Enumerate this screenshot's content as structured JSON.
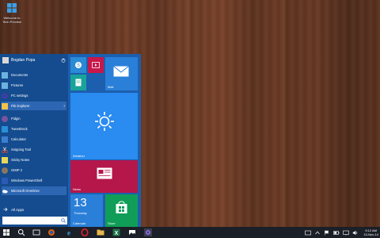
{
  "desktop": {
    "icon_label": "Welcome to Tech Preview"
  },
  "start_menu": {
    "user_name": "Bogdan Popa",
    "items": [
      {
        "label": "Documents",
        "icon": "folder-icon",
        "color": "#6cb3e0"
      },
      {
        "label": "Pictures",
        "icon": "folder-icon",
        "color": "#6cb3e0"
      },
      {
        "label": "PC settings",
        "icon": "gear-icon",
        "color": "#4c3aa8"
      },
      {
        "label": "File Explorer",
        "icon": "folder-icon",
        "color": "#f2c24a"
      },
      {
        "label": "Pidgin",
        "icon": "pidgin-icon",
        "color": "#7a52a0"
      },
      {
        "label": "TweetDeck",
        "icon": "tweetdeck-icon",
        "color": "#2a8fd6"
      },
      {
        "label": "Calculator",
        "icon": "calculator-icon",
        "color": "#3b7fd1"
      },
      {
        "label": "Snipping Tool",
        "icon": "scissors-icon",
        "color": "#d14a3a"
      },
      {
        "label": "Sticky Notes",
        "icon": "note-icon",
        "color": "#e8d85a"
      },
      {
        "label": "GIMP 2",
        "icon": "gimp-icon",
        "color": "#8a7660"
      },
      {
        "label": "Windows PowerShell",
        "icon": "powershell-icon",
        "color": "#2b5bb6"
      },
      {
        "label": "Microsoft OneDrive",
        "icon": "onedrive-icon",
        "color": "#ffffff"
      }
    ],
    "all_apps_label": "All Apps"
  },
  "tiles": {
    "mail": "Mail",
    "weather": "Weather",
    "news": "News",
    "calendar_day": "13",
    "calendar_weekday": "Thursday",
    "calendar": "Calendar",
    "store": "Store"
  },
  "tray": {
    "time": "9:12 AM",
    "date": "13-Nov-14"
  }
}
